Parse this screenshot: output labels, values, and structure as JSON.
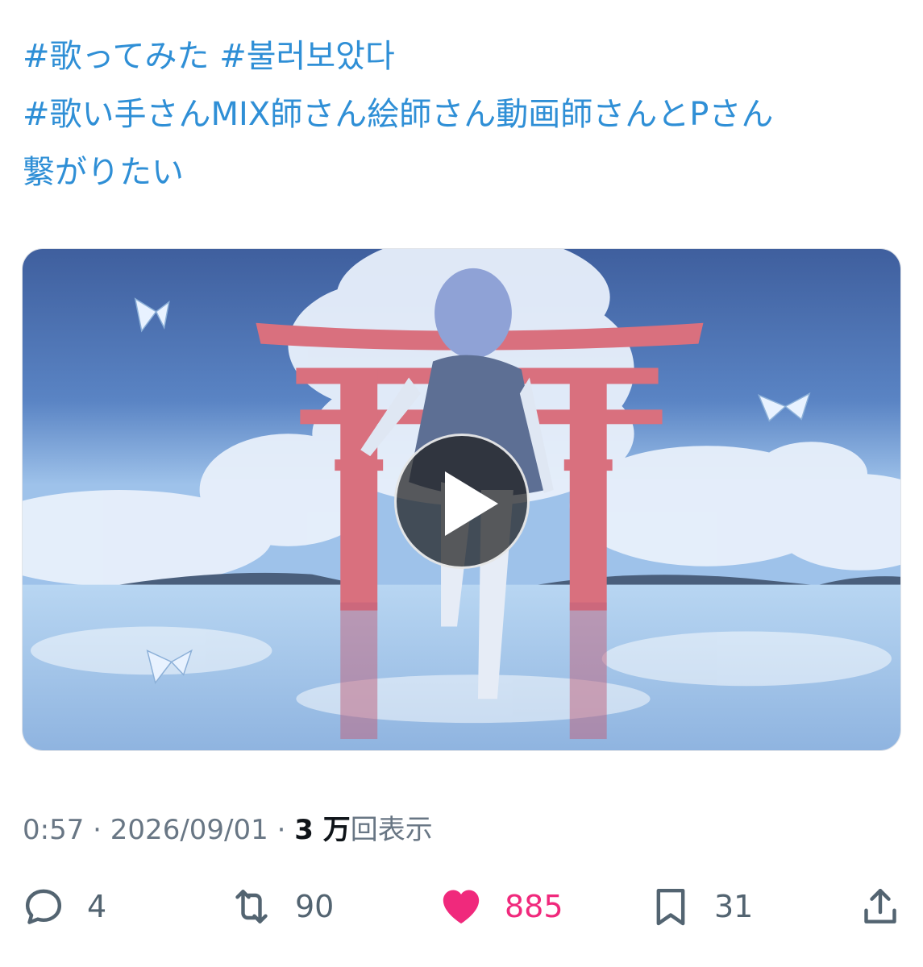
{
  "hashtags": {
    "line1": [
      "#歌ってみた",
      "#불러보았다"
    ],
    "line2": "#歌い手さんMIX師さん絵師さん動画師さんとPさん",
    "line3": "繋がりたい"
  },
  "video": {
    "duration": "0:57"
  },
  "meta": {
    "duration": "0:57",
    "separator": " · ",
    "date": "2026/09/01",
    "views_number": "3 万",
    "views_suffix": "回表示"
  },
  "actions": {
    "replies": "4",
    "retweets": "90",
    "likes": "885",
    "bookmarks": "31"
  },
  "colors": {
    "link": "#2f8fd6",
    "like": "#f0297c",
    "muted": "#687684"
  }
}
